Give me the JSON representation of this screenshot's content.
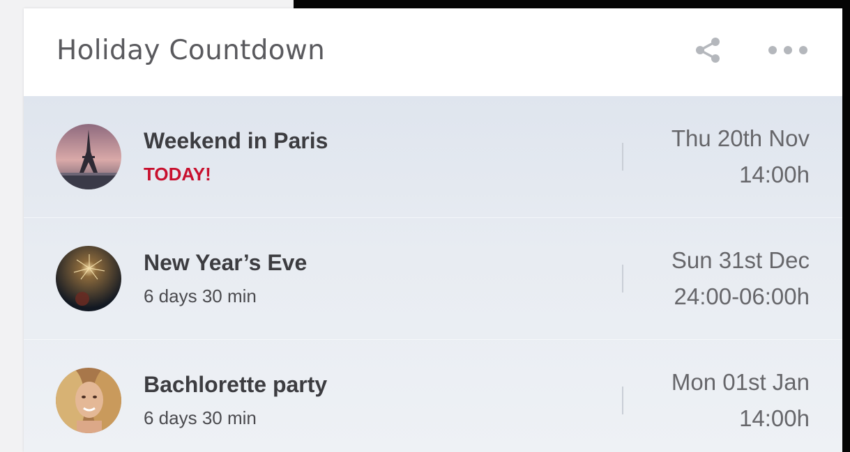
{
  "widget": {
    "title": "Holiday Countdown",
    "actions": {
      "share_icon": "share-icon",
      "more_icon": "more-horizontal-icon"
    }
  },
  "events": [
    {
      "name": "Weekend in Paris",
      "countdown": "TODAY!",
      "is_today": true,
      "date": "Thu 20th Nov",
      "time": "14:00h",
      "avatar": "eiffel-tower-photo"
    },
    {
      "name": "New Year’s Eve",
      "countdown": "6 days 30 min",
      "is_today": false,
      "date": "Sun 31st Dec",
      "time": "24:00-06:00h",
      "avatar": "fireworks-photo"
    },
    {
      "name": "Bachlorette party",
      "countdown": "6 days 30 min",
      "is_today": false,
      "date": "Mon 01st Jan",
      "time": "14:00h",
      "avatar": "woman-portrait-photo"
    }
  ],
  "colors": {
    "today": "#c8102e",
    "title": "#5a5a5e",
    "list_bg": "#e4e9f0"
  }
}
